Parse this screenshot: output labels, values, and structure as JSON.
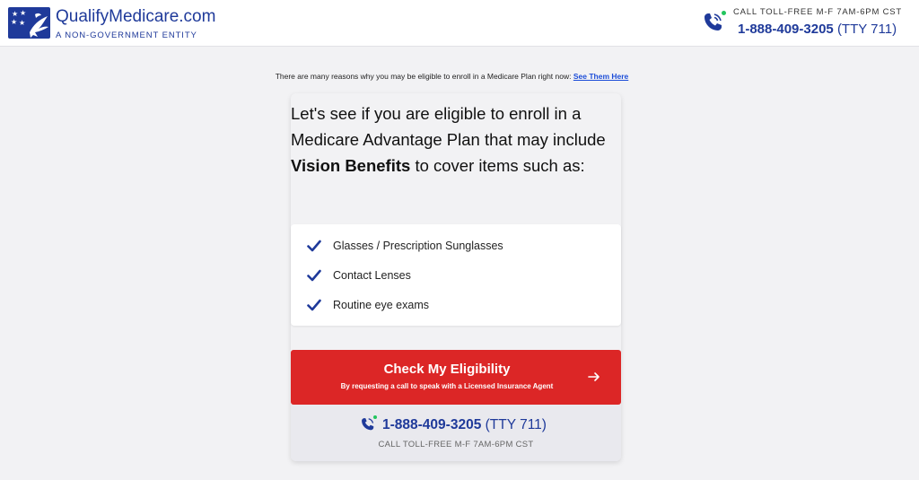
{
  "header": {
    "brand": "QualifyMedicare.com",
    "tagline": "A NON-GOVERNMENT ENTITY",
    "call_label": "CALL TOLL-FREE M-F 7AM-6PM CST",
    "phone": "1-888-409-3205",
    "tty": "(TTY 711)"
  },
  "notice": {
    "text": "There are many reasons why you may be eligible to enroll in a Medicare Plan right now:",
    "link": "See Them Here"
  },
  "headline": {
    "before": "Let's see if you are eligible to enroll in a Medicare Advantage Plan that may include",
    "bold": "Vision Benefits",
    "after": "to cover items such as:"
  },
  "benefits": [
    "Glasses / Prescription Sunglasses",
    "Contact Lenses",
    "Routine eye exams"
  ],
  "cta": {
    "title": "Check My Eligibility",
    "subtitle": "By requesting a call to speak with a Licensed Insurance Agent"
  },
  "call_box": {
    "phone": "1-888-409-3205",
    "tty": "(TTY 711)",
    "hours": "CALL TOLL-FREE M-F 7AM-6PM CST"
  },
  "colors": {
    "brand_blue": "#1f3a9a",
    "cta_red": "#dc2626",
    "status_green": "#22c55e"
  },
  "icons": [
    "logo-eagle-icon",
    "phone-call-icon",
    "check-icon",
    "arrow-right-icon"
  ]
}
